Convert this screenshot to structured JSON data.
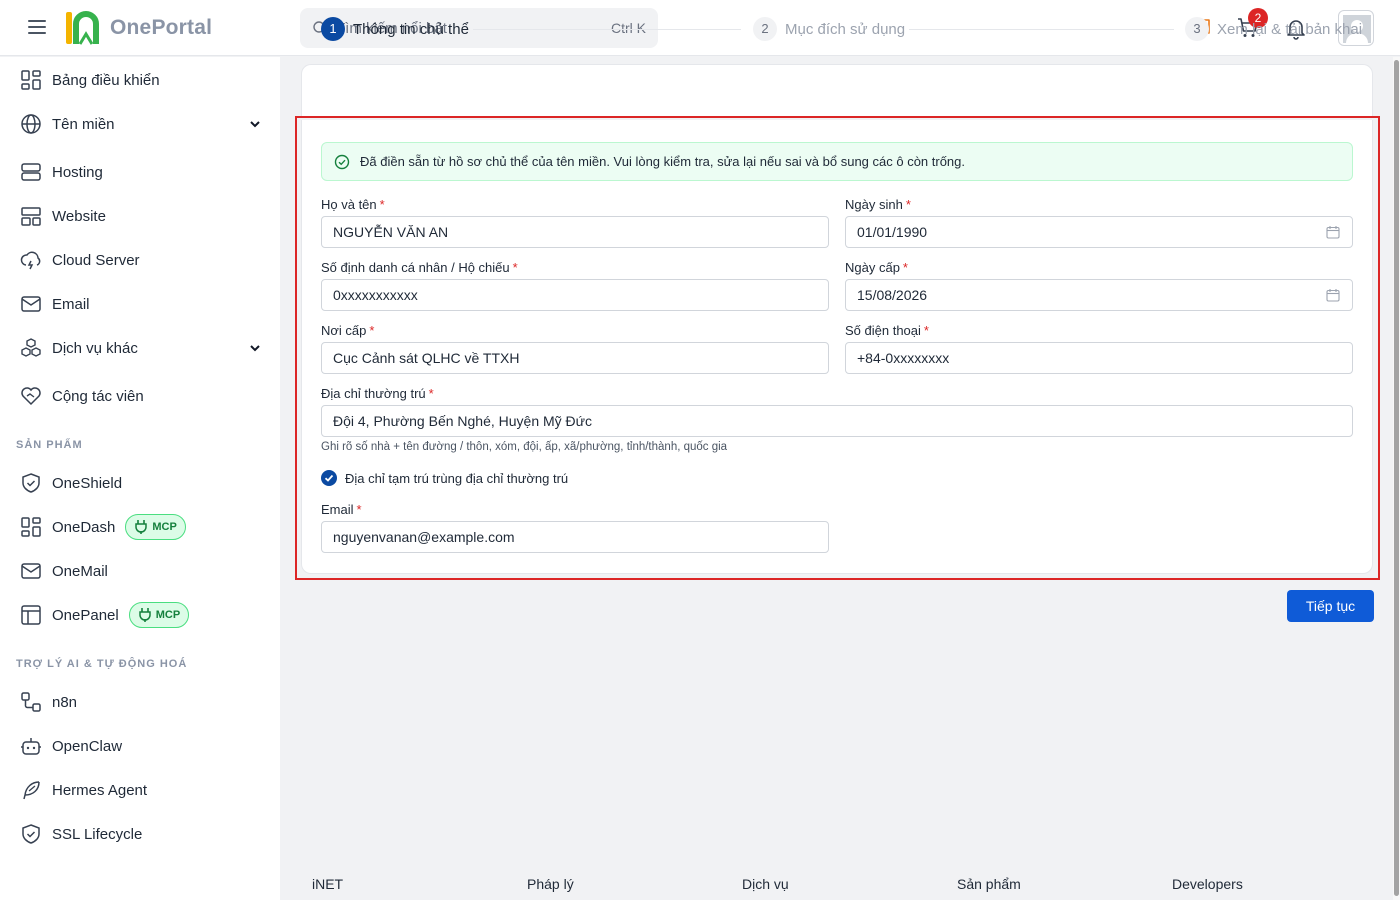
{
  "header": {
    "logo_text": "OnePortal",
    "search_placeholder": "Tìm kiếm nổi bật",
    "search_shortcut": "Ctrl K",
    "cart_count": "2"
  },
  "sidebar": {
    "items": [
      {
        "label": "Bảng điều khiển"
      },
      {
        "label": "Tên miền"
      },
      {
        "label": "Hosting"
      },
      {
        "label": "Website"
      },
      {
        "label": "Cloud Server"
      },
      {
        "label": "Email"
      },
      {
        "label": "Dịch vụ khác"
      },
      {
        "label": "Cộng tác viên"
      }
    ],
    "products_title": "SẢN PHẨM",
    "products": [
      {
        "label": "OneShield"
      },
      {
        "label": "OneDash",
        "badge": "MCP"
      },
      {
        "label": "OneMail"
      },
      {
        "label": "OnePanel",
        "badge": "MCP"
      }
    ],
    "ai_title": "TRỢ LÝ AI & TỰ ĐỘNG HOÁ",
    "ai_items": [
      {
        "label": "n8n"
      },
      {
        "label": "OpenClaw"
      },
      {
        "label": "Hermes Agent"
      },
      {
        "label": "SSL Lifecycle"
      }
    ]
  },
  "stepper": {
    "steps": [
      {
        "num": "1",
        "label": "Thông tin chủ thể",
        "active": true
      },
      {
        "num": "2",
        "label": "Mục đích sử dụng",
        "active": false
      },
      {
        "num": "3",
        "label": "Xem lại & tải bản khai",
        "active": false
      }
    ]
  },
  "form": {
    "alert": "Đã điền sẵn từ hồ sơ chủ thể của tên miền. Vui lòng kiểm tra, sửa lại nếu sai và bổ sung các ô còn trống.",
    "full_name": {
      "label": "Họ và tên",
      "value": "NGUYỄN VĂN AN"
    },
    "dob": {
      "label": "Ngày sinh",
      "value": "01/01/1990"
    },
    "id_number": {
      "label": "Số định danh cá nhân / Hộ chiếu",
      "value": "0xxxxxxxxxxx"
    },
    "issue_date": {
      "label": "Ngày cấp",
      "value": "15/08/2026"
    },
    "issue_place": {
      "label": "Nơi cấp",
      "value": "Cục Cảnh sát QLHC về TTXH"
    },
    "phone": {
      "label": "Số điện thoại",
      "value": "+84-0xxxxxxxx"
    },
    "address": {
      "label": "Địa chỉ thường trú",
      "value": "Đội 4, Phường Bến Nghé, Huyện Mỹ Đức"
    },
    "address_hint": "Ghi rõ số nhà + tên đường / thôn, xóm, đội, ấp, xã/phường, tỉnh/thành, quốc gia",
    "same_address_label": "Địa chỉ tạm trú trùng địa chỉ thường trú",
    "email": {
      "label": "Email",
      "value": "nguyenvanan@example.com"
    },
    "required_mark": "*"
  },
  "actions": {
    "continue_label": "Tiếp tục"
  },
  "footer": {
    "columns": [
      "iNET",
      "Pháp lý",
      "Dịch vụ",
      "Sản phẩm",
      "Developers"
    ]
  },
  "colors": {
    "primary": "#0b4aa2",
    "button": "#0f5bd7",
    "required": "#dc2626",
    "highlight_border": "#dc2626",
    "alert_bg": "#ecfdf3"
  }
}
